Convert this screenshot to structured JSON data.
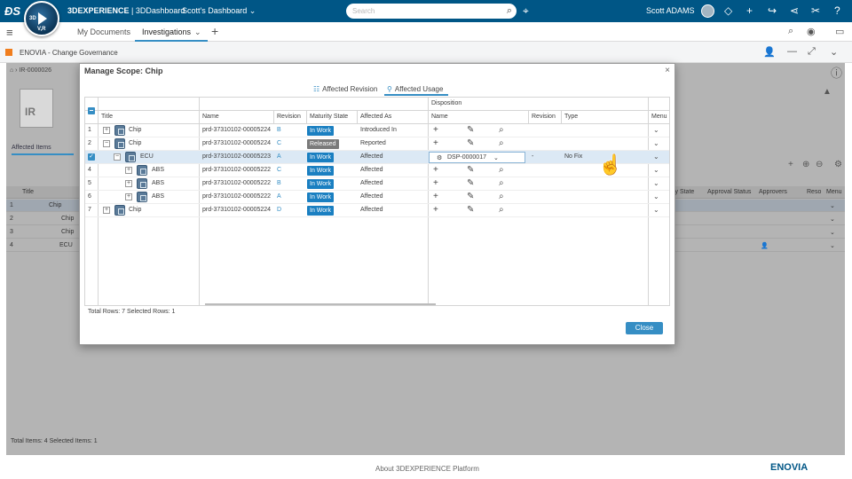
{
  "topbar": {
    "brand_bold": "3DEXPERIENCE",
    "brand_app": " | 3DDashboard",
    "dashboard_title": "Scott's Dashboard ⌄",
    "search_placeholder": "Search",
    "user_name": "Scott ADAMS",
    "compass_3d": "3D",
    "compass_vr": "V,R"
  },
  "tabs": {
    "my_documents": "My Documents",
    "investigations": "Investigations"
  },
  "app": {
    "title": "ENOVIA - Change Governance"
  },
  "background": {
    "breadcrumb": "IR-0000026",
    "thumb_label": "IR",
    "affected_items_tab": "Affected Items",
    "header": {
      "title": "Title",
      "maturity": "ity State",
      "approval": "Approval Status",
      "approvers": "Approvers",
      "reso": "Reso",
      "menu": "Menu"
    },
    "rows": [
      {
        "num": "1",
        "title": "Chip"
      },
      {
        "num": "2",
        "title": "Chip"
      },
      {
        "num": "3",
        "title": "Chip"
      },
      {
        "num": "4",
        "title": "ECU"
      }
    ],
    "footer": "Total Items: 4   Selected Items: 1"
  },
  "modal": {
    "title": "Manage Scope: Chip",
    "tab_revision": "Affected Revision",
    "tab_usage": "Affected Usage",
    "header_group": "Disposition",
    "columns": {
      "title": "Title",
      "name": "Name",
      "revision": "Revision",
      "maturity": "Maturity State",
      "affected_as": "Affected As",
      "disp_name": "Name",
      "disp_revision": "Revision",
      "type": "Type",
      "menu": "Menu"
    },
    "rows": [
      {
        "num": "1",
        "title": "Chip",
        "name": "prd-37310102-00005224",
        "rev": "B",
        "state": "In Work",
        "affected_as": "Introduced In"
      },
      {
        "num": "2",
        "title": "Chip",
        "name": "prd-37310102-00005224",
        "rev": "C",
        "state": "Released",
        "affected_as": "Reported"
      },
      {
        "num": "3",
        "title": "ECU",
        "name": "prd-37310102-00005223",
        "rev": "A",
        "state": "In Work",
        "affected_as": "Affected",
        "disp_name": "DSP-0000017",
        "disp_rev": "-",
        "type": "No Fix"
      },
      {
        "num": "4",
        "title": "ABS",
        "name": "prd-37310102-00005222",
        "rev": "C",
        "state": "In Work",
        "affected_as": "Affected"
      },
      {
        "num": "5",
        "title": "ABS",
        "name": "prd-37310102-00005222",
        "rev": "B",
        "state": "In Work",
        "affected_as": "Affected"
      },
      {
        "num": "6",
        "title": "ABS",
        "name": "prd-37310102-00005222",
        "rev": "A",
        "state": "In Work",
        "affected_as": "Affected"
      },
      {
        "num": "7",
        "title": "Chip",
        "name": "prd-37310102-00005224",
        "rev": "D",
        "state": "In Work",
        "affected_as": "Affected"
      }
    ],
    "footer": "Total Rows: 7    Selected Rows: 1",
    "close_label": "Close"
  },
  "footer": {
    "about": "About 3DEXPERIENCE Platform",
    "brand": "ENOVIA"
  },
  "colors": {
    "topbar": "#005686",
    "accent": "#368ec4",
    "in_work": "#1a7fc1",
    "released": "#7a7a7a"
  }
}
